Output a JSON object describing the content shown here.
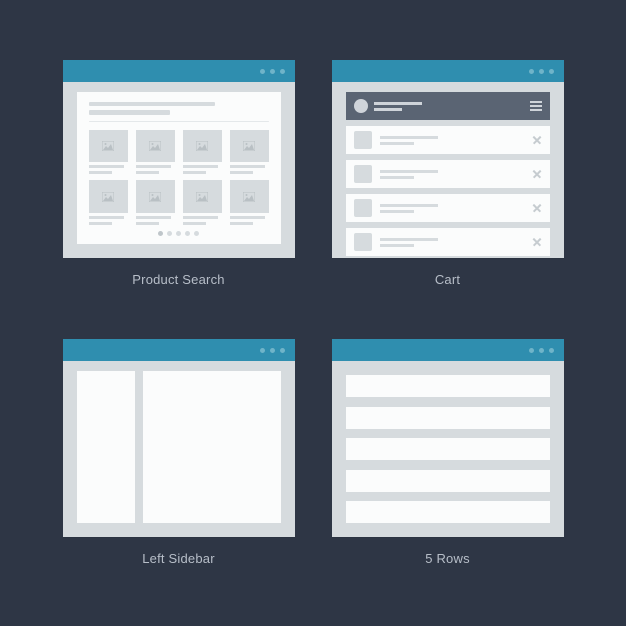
{
  "captions": {
    "product_search": "Product Search",
    "cart": "Cart",
    "left_sidebar": "Left Sidebar",
    "five_rows": "5 Rows"
  },
  "colors": {
    "background": "#2e3645",
    "window_chrome": "#2f8eaf",
    "window_body": "#d6dbde",
    "panel": "#fbfcfc",
    "cart_header": "#5a6473"
  },
  "product_search": {
    "grid_count": 8,
    "pager_count": 5,
    "pager_active_index": 0
  },
  "cart": {
    "row_count": 4
  },
  "five_rows": {
    "row_count": 5
  }
}
